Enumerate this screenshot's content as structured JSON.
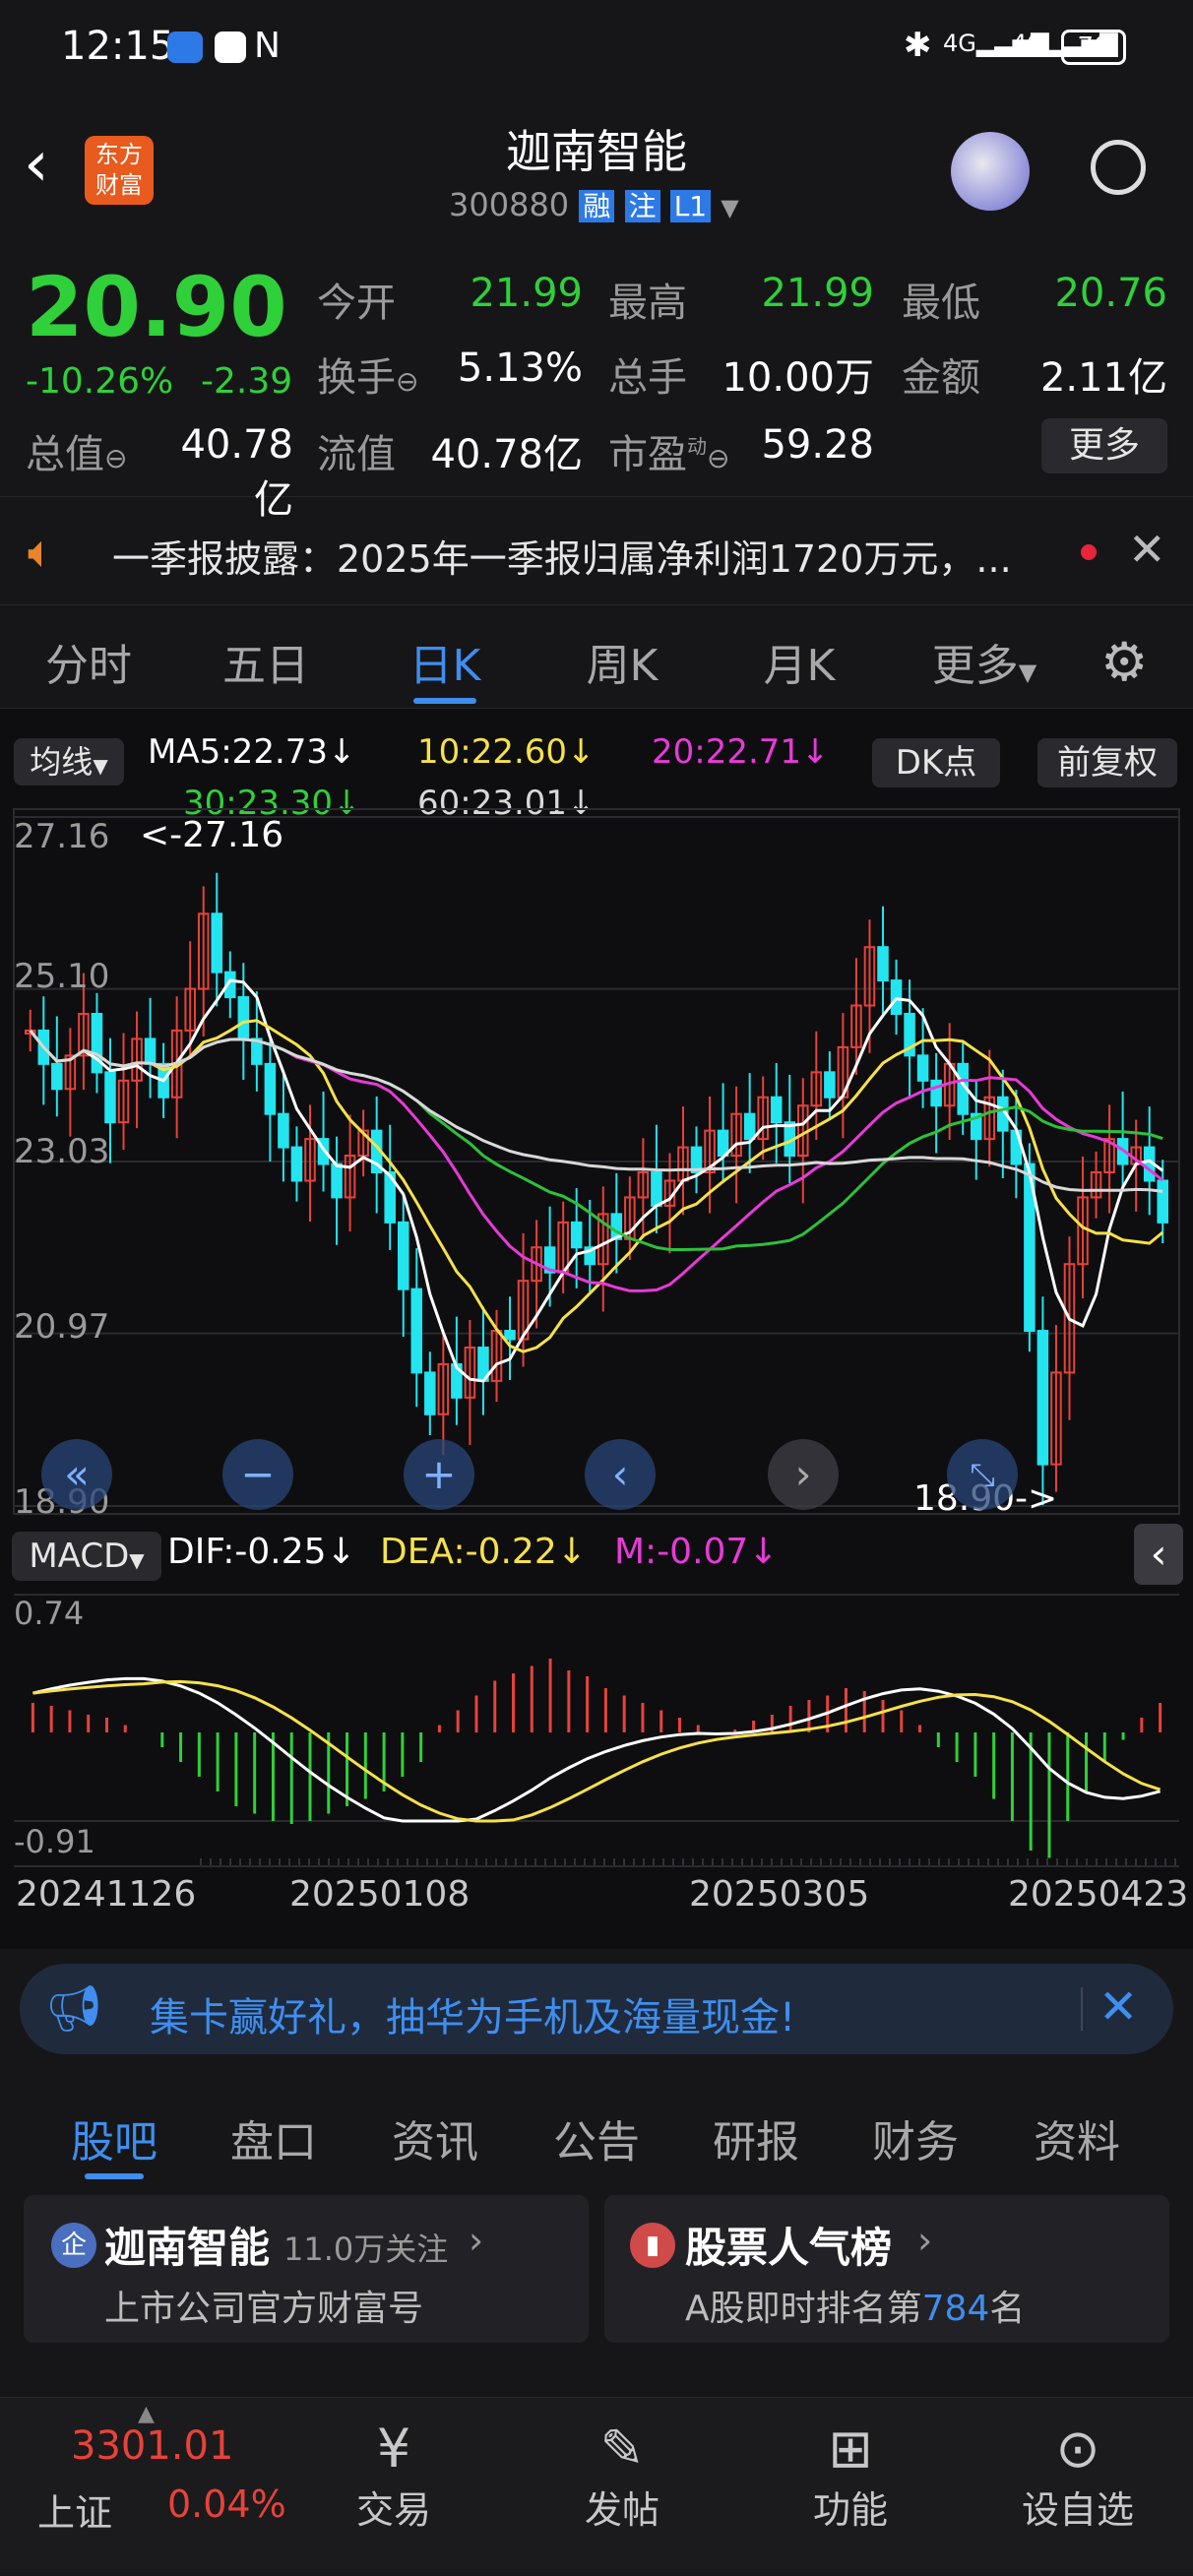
{
  "status": {
    "time": "12:15",
    "battery": "70"
  },
  "header": {
    "title": "迦南智能",
    "code": "300880",
    "badge1": "融",
    "badge2": "注",
    "badge3": "L1",
    "logo_line1": "东方",
    "logo_line2": "财富"
  },
  "quote": {
    "price": "20.90",
    "pct": "-10.26%",
    "chg": "-2.39",
    "open_l": "今开",
    "open_v": "21.99",
    "high_l": "最高",
    "high_v": "21.99",
    "low_l": "最低",
    "low_v": "20.76",
    "turn_l": "换手",
    "turn_v": "5.13%",
    "vol_l": "总手",
    "vol_v": "10.00万",
    "amt_l": "金额",
    "amt_v": "2.11亿",
    "mcap_l": "总值",
    "mcap_v": "40.78亿",
    "fcap_l": "流值",
    "fcap_v": "40.78亿",
    "pe_l": "市盈",
    "pe_sup": "动",
    "pe_v": "59.28",
    "more": "更多"
  },
  "notice": {
    "text": "一季报披露：2025年一季报归属净利润1720万元，..."
  },
  "ktabs": [
    "分时",
    "五日",
    "日K",
    "周K",
    "月K",
    "更多"
  ],
  "legend": {
    "ma_btn": "均线",
    "ma5": "MA5:22.73↓",
    "ma10": "10:22.60↓",
    "ma20": "20:22.71↓",
    "ma30": "30:23.30↓",
    "ma60": "60:23.01↓",
    "dk": "DK点",
    "fq": "前复权"
  },
  "price_axis": [
    "27.16",
    "25.10",
    "23.03",
    "20.97",
    "18.90"
  ],
  "max_label": "<-27.16",
  "min_label": "18.90->",
  "macd": {
    "btn": "MACD",
    "dif": "DIF:-0.25↓",
    "dea": "DEA:-0.22↓",
    "m": "M:-0.07↓",
    "top": "0.74",
    "bottom": "-0.91"
  },
  "dates": [
    "20241126",
    "20250108",
    "20250305",
    "20250423"
  ],
  "ad": {
    "text": "集卡赢好礼，抽华为手机及海量现金!"
  },
  "ftabs": [
    "股吧",
    "盘口",
    "资讯",
    "公告",
    "研报",
    "财务",
    "资料"
  ],
  "card1": {
    "title": "迦南智能",
    "follow": "11.0万关注",
    "sub": "上市公司官方财富号",
    "badge": "企"
  },
  "card2": {
    "title": "股票人气榜",
    "sub_a": "A股即时排名第",
    "sub_b": "784",
    "sub_c": "名"
  },
  "bottom": {
    "index_val": "3301.01",
    "index_name": "上证",
    "index_pct": "0.04%",
    "trade": "交易",
    "post": "发帖",
    "func": "功能",
    "watch": "设自选"
  },
  "colors": {
    "up": "#e8423a",
    "down": "#2fd03a",
    "accent": "#3f8ef0",
    "candle_down": "#22e5f0",
    "ma5": "#ffffff",
    "ma10": "#f6e14a",
    "ma20": "#e83ad8",
    "ma30": "#2fbf3a",
    "ma60": "#d8d8d8"
  },
  "chart_data": {
    "type": "candlestick",
    "ylim": [
      18.9,
      27.16
    ],
    "y_ticks": [
      27.16,
      25.1,
      23.03,
      20.97,
      18.9
    ],
    "x_ticks": [
      "20241126",
      "20250108",
      "20250305",
      "20250423"
    ],
    "series": [
      {
        "name": "MA5",
        "last": 22.73
      },
      {
        "name": "10",
        "last": 22.6
      },
      {
        "name": "20",
        "last": 22.71
      },
      {
        "name": "30",
        "last": 23.3
      },
      {
        "name": "60",
        "last": 23.01
      }
    ],
    "closes": [
      24.6,
      24.2,
      23.9,
      24.3,
      24.8,
      24.1,
      23.5,
      24.0,
      24.5,
      24.2,
      23.8,
      24.6,
      25.1,
      26.0,
      25.3,
      25.0,
      24.5,
      24.2,
      23.6,
      23.2,
      22.8,
      23.3,
      23.0,
      22.6,
      23.1,
      23.4,
      22.9,
      22.3,
      21.5,
      20.5,
      20.0,
      20.6,
      20.2,
      20.8,
      20.4,
      21.0,
      20.9,
      21.6,
      22.0,
      21.7,
      22.3,
      22.0,
      21.8,
      22.4,
      22.1,
      22.6,
      22.9,
      22.5,
      22.8,
      23.2,
      22.9,
      23.4,
      23.1,
      23.6,
      23.3,
      23.8,
      23.5,
      23.1,
      23.7,
      24.1,
      23.8,
      24.4,
      24.9,
      25.6,
      25.2,
      24.8,
      24.3,
      24.0,
      23.7,
      24.2,
      23.6,
      23.3,
      23.8,
      23.4,
      23.0,
      21.0,
      19.4,
      20.5,
      21.8,
      22.6,
      22.9,
      23.3,
      23.0,
      23.2,
      22.8,
      22.3
    ],
    "macd_hist": [
      0.2,
      0.18,
      0.15,
      0.12,
      0.1,
      0.05,
      0,
      -0.1,
      -0.2,
      -0.3,
      -0.4,
      -0.5,
      -0.55,
      -0.6,
      -0.62,
      -0.6,
      -0.55,
      -0.5,
      -0.45,
      -0.4,
      -0.3,
      -0.2,
      0.05,
      0.15,
      0.25,
      0.35,
      0.4,
      0.45,
      0.5,
      0.42,
      0.38,
      0.3,
      0.25,
      0.2,
      0.15,
      0.1,
      0.05,
      -0.02,
      0.02,
      0.08,
      0.12,
      0.18,
      0.22,
      0.25,
      0.3,
      0.28,
      0.22,
      0.15,
      0.05,
      -0.1,
      -0.2,
      -0.3,
      -0.45,
      -0.6,
      -0.8,
      -0.85,
      -0.6,
      -0.4,
      -0.2,
      -0.05,
      0.1,
      0.2
    ]
  }
}
